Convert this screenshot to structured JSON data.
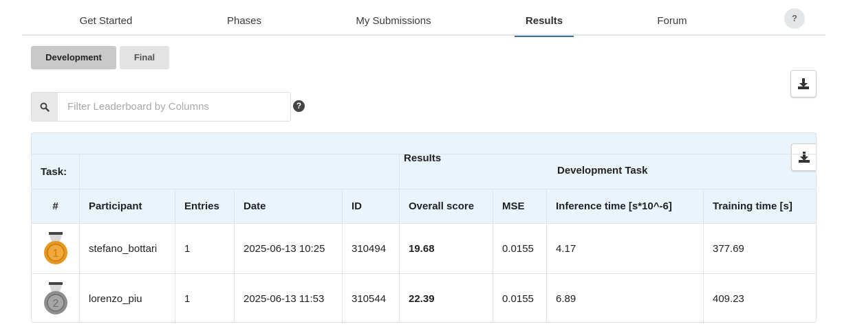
{
  "nav": {
    "tabs": [
      {
        "label": "Get Started"
      },
      {
        "label": "Phases"
      },
      {
        "label": "My Submissions"
      },
      {
        "label": "Results"
      },
      {
        "label": "Forum"
      }
    ],
    "active_tab": "Results",
    "help_label": "?"
  },
  "phases": {
    "development_label": "Development",
    "final_label": "Final",
    "selected": "Development"
  },
  "filter": {
    "placeholder": "Filter Leaderboard by Columns",
    "value": "",
    "help_label": "?"
  },
  "icons": {
    "search": "search-icon",
    "download": "download-icon",
    "help": "question-circle-icon",
    "medal_gold": "gold-medal-icon",
    "medal_silver": "silver-medal-icon"
  },
  "colors": {
    "accent": "#3d6e94",
    "link": "#2f7bbf",
    "header_bg": "#eaf4fd",
    "gold": "#e8961e",
    "silver": "#8e8e8e"
  },
  "table": {
    "task_label": "Task:",
    "results_label": "Results",
    "development_task_label": "Development Task",
    "columns": [
      "#",
      "Participant",
      "Entries",
      "Date",
      "ID",
      "Overall score",
      "MSE",
      "Inference time [s*10^-6]",
      "Training time [s]"
    ],
    "rows": [
      {
        "rank": "1",
        "participant": "stefano_bottari",
        "entries": "1",
        "date": "2025-06-13 10:25",
        "id": "310494",
        "overall_score": "19.68",
        "mse": "0.0155",
        "inference_time": "4.17",
        "training_time": "377.69"
      },
      {
        "rank": "2",
        "participant": "lorenzo_piu",
        "entries": "1",
        "date": "2025-06-13 11:53",
        "id": "310544",
        "overall_score": "22.39",
        "mse": "0.0155",
        "inference_time": "6.89",
        "training_time": "409.23"
      }
    ]
  }
}
